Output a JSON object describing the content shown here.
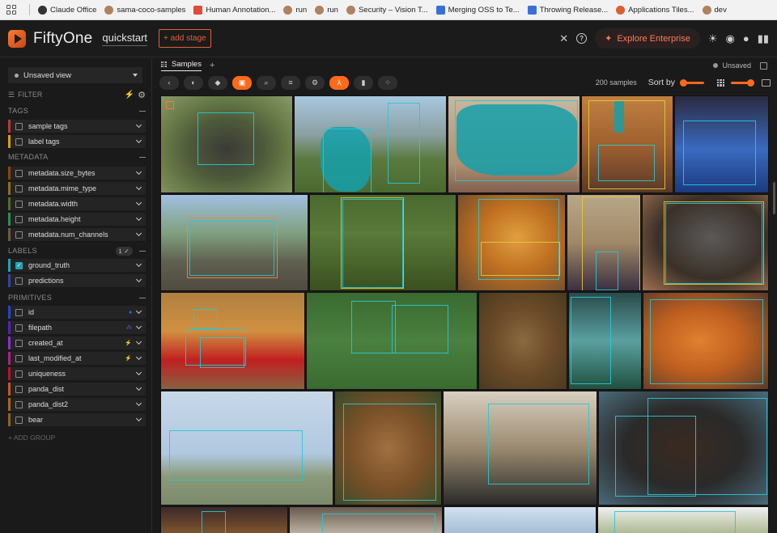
{
  "bookmarks": [
    {
      "label": "Claude Office",
      "color": "#333333"
    },
    {
      "label": "sama-coco-samples",
      "color": "#b08060"
    },
    {
      "label": "Human Annotation...",
      "color": "#e04a3a"
    },
    {
      "label": "run",
      "color": "#b08060"
    },
    {
      "label": "run",
      "color": "#b08060"
    },
    {
      "label": "Security – Vision T...",
      "color": "#b08060"
    },
    {
      "label": "Merging OSS to Te...",
      "color": "#3b6fd8"
    },
    {
      "label": "Throwing Release...",
      "color": "#3b6fd8"
    },
    {
      "label": "Applications Tiles...",
      "color": "#d86030"
    },
    {
      "label": "dev",
      "color": "#b08060"
    }
  ],
  "topnav": {
    "brand": "FiftyOne",
    "dataset": "quickstart",
    "add_stage": "+ add stage",
    "clear": "✕",
    "help": "?",
    "explore": "Explore Enterprise",
    "explore_spark": "✦",
    "theme_icon": "☀",
    "discord_icon": "◉",
    "github_icon": "●",
    "layout_icon": "▮▮"
  },
  "sidebar": {
    "view_select": "Unsaved view",
    "filter_label": "FILTER",
    "bolt": "⚡",
    "gear": "⚙",
    "groups": {
      "tags": "TAGS",
      "metadata": "METADATA",
      "labels": "LABELS",
      "labels_badge": "1 ✓",
      "primitives": "PRIMITIVES"
    },
    "tags": [
      {
        "label": "sample tags",
        "color": "#c0392b"
      },
      {
        "label": "label tags",
        "color": "#d4a017"
      }
    ],
    "metadata": [
      {
        "label": "metadata.size_bytes",
        "color": "#8b4513"
      },
      {
        "label": "metadata.mime_type",
        "color": "#8b6f23"
      },
      {
        "label": "metadata.width",
        "color": "#556b2f"
      },
      {
        "label": "metadata.height",
        "color": "#2e8b57"
      },
      {
        "label": "metadata.num_channels",
        "color": "#6b5b3f"
      }
    ],
    "labels": [
      {
        "label": "ground_truth",
        "color": "#19a8b8",
        "checked": true
      },
      {
        "label": "predictions",
        "color": "#3344aa",
        "checked": false
      }
    ],
    "primitives": [
      {
        "label": "id",
        "color": "#2244cc",
        "type": "♦",
        "type_color": "#4466ff"
      },
      {
        "label": "filepath",
        "color": "#5522bb",
        "type": "⁂",
        "type_color": "#7744ee"
      },
      {
        "label": "created_at",
        "color": "#8833cc",
        "type": "⚡",
        "type_color": "#aa55ee"
      },
      {
        "label": "last_modified_at",
        "color": "#aa2288",
        "type": "⚡",
        "type_color": "#dd44aa"
      },
      {
        "label": "uniqueness",
        "color": "#bb1133",
        "type": "",
        "type_color": "#ccc"
      },
      {
        "label": "panda_dist",
        "color": "#cc5522",
        "type": "",
        "type_color": "#ccc"
      },
      {
        "label": "panda_dist2",
        "color": "#aa6622",
        "type": "",
        "type_color": "#ccc"
      },
      {
        "label": "bear",
        "color": "#886622",
        "type": "",
        "type_color": "#ccc"
      }
    ],
    "add_group": "+ ADD GROUP"
  },
  "main": {
    "tab_label": "Samples",
    "add_tab": "+",
    "unsaved": "Unsaved",
    "sample_count": "200 samples",
    "sort_by": "Sort by",
    "toolbar_icons": [
      "‹",
      "◐",
      "◆",
      "▣",
      "⌕",
      "≡",
      "⚙",
      "⅄",
      "▮",
      "⁘"
    ],
    "active_tool_index": 3,
    "active_tool_index_b": 7
  }
}
